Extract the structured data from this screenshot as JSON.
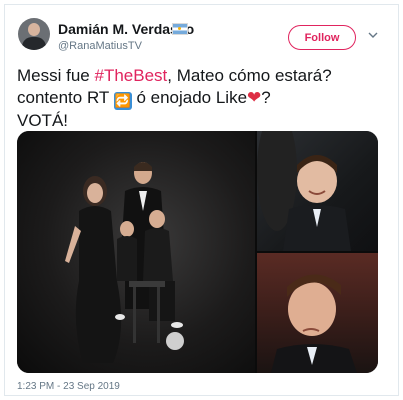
{
  "author": {
    "name": "Damián M. Verdasco",
    "handle": "@RanaMatiusTV"
  },
  "follow_button": {
    "label": "Follow"
  },
  "tweet": {
    "line1_prefix": "Messi fue ",
    "hashtag": "#TheBest",
    "line1_suffix": ", Mateo cómo estará?",
    "line2_prefix": "contento RT ",
    "line2_middle": " ó enojado Like",
    "line2_suffix": "?",
    "line3": "VOTÁ!",
    "rt_emoji_glyph": "🔁",
    "heart_glyph": "❤"
  },
  "media": {
    "images": [
      "main-photo",
      "child-smiling-photo",
      "child-frowning-photo"
    ]
  },
  "timestamp": "1:23 PM - 23 Sep 2019",
  "colors": {
    "accent": "#e0245e",
    "text": "#14171a",
    "muted": "#657786"
  }
}
